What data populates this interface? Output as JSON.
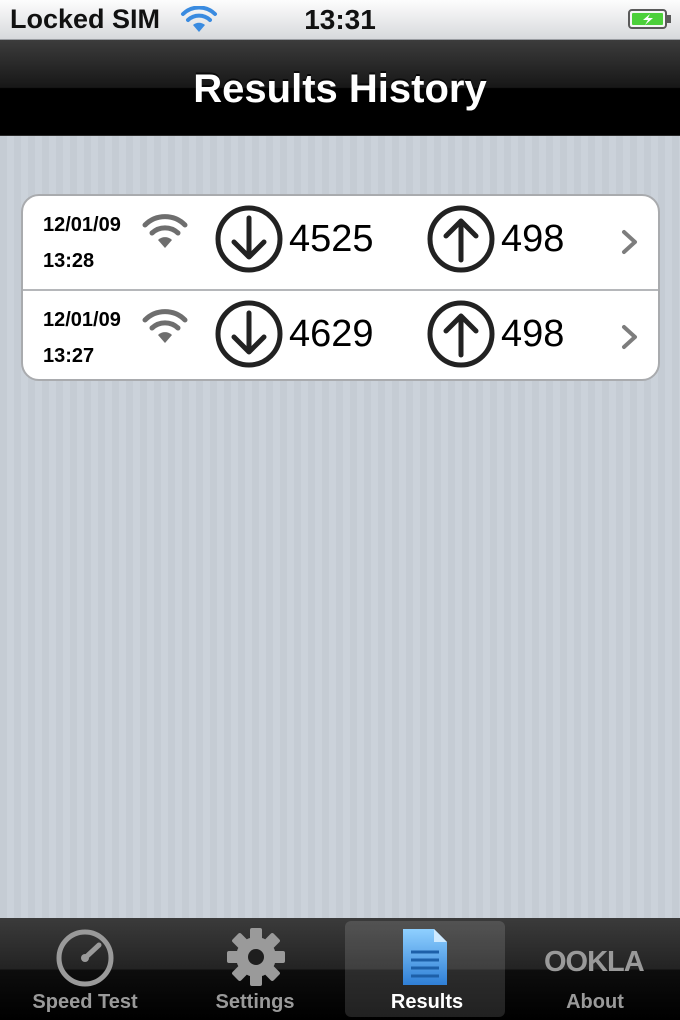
{
  "status_bar": {
    "carrier": "Locked SIM",
    "time": "13:31",
    "wifi_icon": "wifi-icon",
    "battery_icon": "battery-charging-icon"
  },
  "nav": {
    "title": "Results History"
  },
  "results": [
    {
      "date": "12/01/09",
      "time": "13:28",
      "connection_icon": "wifi-icon",
      "download": "4525",
      "upload": "498"
    },
    {
      "date": "12/01/09",
      "time": "13:27",
      "connection_icon": "wifi-icon",
      "download": "4629",
      "upload": "498"
    }
  ],
  "tab_bar": {
    "tabs": [
      {
        "label": "Speed Test",
        "icon": "speedometer-icon",
        "selected": false
      },
      {
        "label": "Settings",
        "icon": "gear-icon",
        "selected": false
      },
      {
        "label": "Results",
        "icon": "document-icon",
        "selected": true
      },
      {
        "label": "About",
        "icon": "ookla-logo",
        "selected": false
      }
    ],
    "about_logo_text": "OOKLA"
  },
  "colors": {
    "accent_blue": "#3a8be0",
    "battery_green": "#4cd03a",
    "pinstripe": "#c5ccd4"
  }
}
